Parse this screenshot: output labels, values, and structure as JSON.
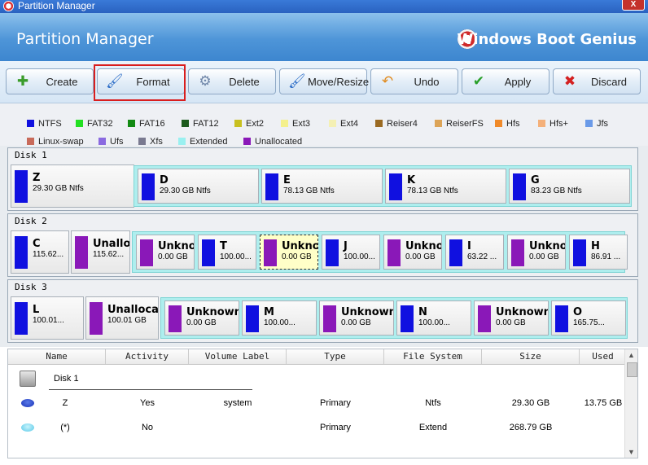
{
  "window": {
    "title": "Partition Manager",
    "close_glyph": "X"
  },
  "header": {
    "title": "Partition Manager",
    "brand": "Windows Boot Genius"
  },
  "toolbar": {
    "buttons": [
      {
        "label": "Create",
        "icon": "create-icon",
        "glyph": "✚",
        "color": "#3a9c2a"
      },
      {
        "label": "Format",
        "icon": "format-icon",
        "glyph": "🖌",
        "color": "#2f6fc8"
      },
      {
        "label": "Delete",
        "icon": "delete-icon",
        "glyph": "⚙",
        "color": "#6f86a8"
      },
      {
        "label": "Move/Resize",
        "icon": "move-resize-icon",
        "glyph": "🖌",
        "color": "#2f6fc8"
      },
      {
        "label": "Undo",
        "icon": "undo-icon",
        "glyph": "↶",
        "color": "#e08a1e"
      },
      {
        "label": "Apply",
        "icon": "apply-icon",
        "glyph": "✔",
        "color": "#2aa02a"
      },
      {
        "label": "Discard",
        "icon": "discard-icon",
        "glyph": "✖",
        "color": "#d42020"
      }
    ]
  },
  "legend": [
    {
      "label": "NTFS",
      "color": "#1010e0"
    },
    {
      "label": "FAT32",
      "color": "#22e022"
    },
    {
      "label": "FAT16",
      "color": "#138a13"
    },
    {
      "label": "FAT12",
      "color": "#1c5a1c"
    },
    {
      "label": "Ext2",
      "color": "#c8c020"
    },
    {
      "label": "Ext3",
      "color": "#f4f08c"
    },
    {
      "label": "Ext4",
      "color": "#f4f0b4"
    },
    {
      "label": "Reiser4",
      "color": "#9a6a22"
    },
    {
      "label": "ReiserFS",
      "color": "#dca458"
    },
    {
      "label": "Hfs",
      "color": "#f08a2a"
    },
    {
      "label": "Hfs+",
      "color": "#f4b07a"
    },
    {
      "label": "Jfs",
      "color": "#6a9ae8"
    },
    {
      "label": "Linux-swap",
      "color": "#c86a5a"
    },
    {
      "label": "Ufs",
      "color": "#8a6ae0"
    },
    {
      "label": "Xfs",
      "color": "#7a7a90"
    },
    {
      "label": "Extended",
      "color": "#9af0f0"
    },
    {
      "label": "Unallocated",
      "color": "#8a18b8"
    }
  ],
  "disks": [
    {
      "label": "Disk 1",
      "primary": [
        {
          "name": "Z",
          "size": "29.30 GB Ntfs",
          "color": "#1010e0"
        }
      ],
      "logical": [
        {
          "name": "D",
          "size": "29.30 GB Ntfs",
          "color": "#1010e0"
        },
        {
          "name": "E",
          "size": "78.13 GB Ntfs",
          "color": "#1010e0"
        },
        {
          "name": "K",
          "size": "78.13 GB Ntfs",
          "color": "#1010e0"
        },
        {
          "name": "G",
          "size": "83.23 GB Ntfs",
          "color": "#1010e0"
        }
      ]
    },
    {
      "label": "Disk 2",
      "primary": [
        {
          "name": "C",
          "size": "115.62...",
          "color": "#1010e0"
        },
        {
          "name": "Unallo",
          "size": "115.62...",
          "color": "#8a18b8"
        }
      ],
      "logical": [
        {
          "name": "Unknow",
          "size": "0.00 GB",
          "color": "#8a18b8"
        },
        {
          "name": "T",
          "size": "100.00...",
          "color": "#1010e0"
        },
        {
          "name": "Unknow",
          "size": "0.00 GB",
          "color": "#8a18b8",
          "selected": true
        },
        {
          "name": "J",
          "size": "100.00...",
          "color": "#1010e0"
        },
        {
          "name": "Unkno",
          "size": "0.00 GB",
          "color": "#8a18b8"
        },
        {
          "name": "I",
          "size": "63.22 ...",
          "color": "#1010e0"
        },
        {
          "name": "Unkno",
          "size": "0.00 GB",
          "color": "#8a18b8"
        },
        {
          "name": "H",
          "size": "86.91 ...",
          "color": "#1010e0"
        }
      ]
    },
    {
      "label": "Disk 3",
      "primary": [
        {
          "name": "L",
          "size": "100.01...",
          "color": "#1010e0"
        },
        {
          "name": "Unallocate",
          "size": "100.01 GB",
          "color": "#8a18b8"
        }
      ],
      "logical": [
        {
          "name": "Unknown",
          "size": "0.00 GB",
          "color": "#8a18b8"
        },
        {
          "name": "M",
          "size": "100.00...",
          "color": "#1010e0"
        },
        {
          "name": "Unknown",
          "size": "0.00 GB",
          "color": "#8a18b8"
        },
        {
          "name": "N",
          "size": "100.00...",
          "color": "#1010e0"
        },
        {
          "name": "Unknown",
          "size": "0.00 GB",
          "color": "#8a18b8"
        },
        {
          "name": "O",
          "size": "165.75...",
          "color": "#1010e0"
        }
      ]
    }
  ],
  "table": {
    "columns": [
      "Name",
      "Activity",
      "Volume Label",
      "Type",
      "File System",
      "Size",
      "Used"
    ],
    "group": "Disk 1",
    "rows": [
      {
        "icon": "partition-icon",
        "name": "Z",
        "activity": "Yes",
        "volume_label": "system",
        "type": "Primary",
        "file_system": "Ntfs",
        "size": "29.30 GB",
        "used": "13.75 GB"
      },
      {
        "icon": "extended-partition-icon",
        "name": "(*)",
        "activity": "No",
        "volume_label": "",
        "type": "Primary",
        "file_system": "Extend",
        "size": "268.79 GB",
        "used": ""
      }
    ]
  }
}
